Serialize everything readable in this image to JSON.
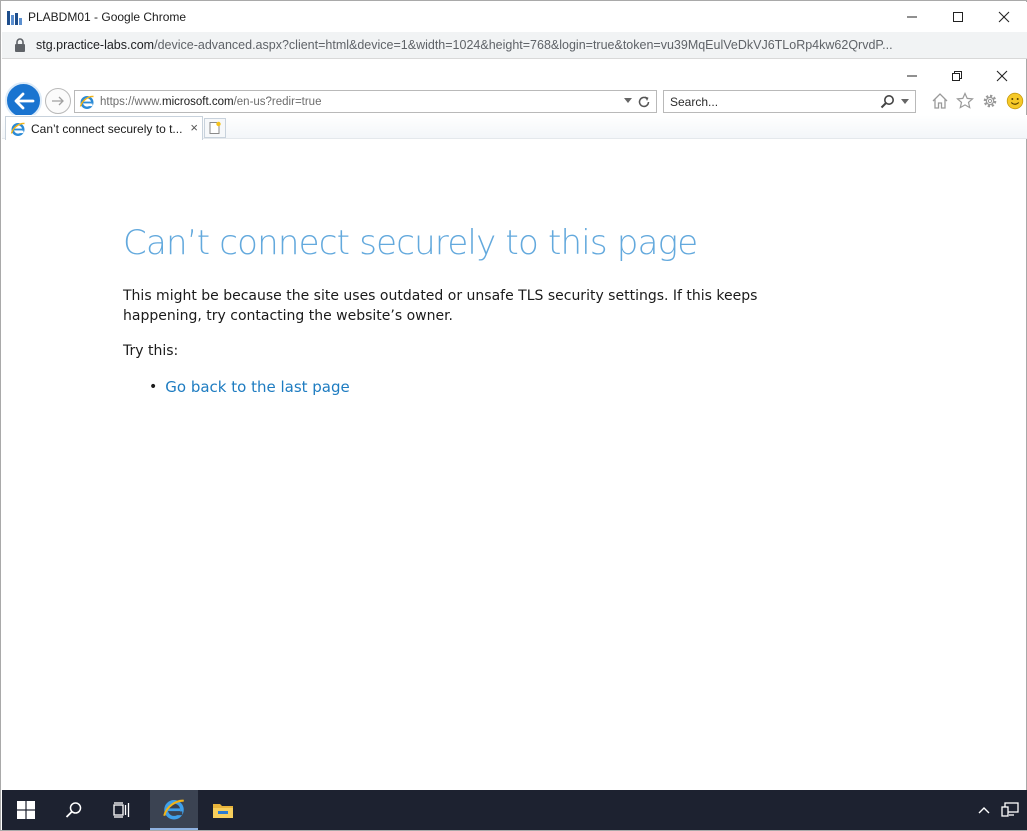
{
  "chrome": {
    "window_title": "PLABDM01 - Google Chrome",
    "url_host": "stg.practice-labs.com",
    "url_path": "/device-advanced.aspx?client=html&device=1&width=1024&height=768&login=true&token=vu39MqEulVeDkVJ6TLoRp4kw62QrvdP..."
  },
  "ie": {
    "address_prefix": "https://www.",
    "address_host": "microsoft.com",
    "address_path": "/en-us?redir=true",
    "search_placeholder": "Search...",
    "tab_title": "Can’t connect securely to t...",
    "tab_close": "×"
  },
  "page": {
    "title": "Can’t connect securely to this page",
    "description": "This might be because the site uses outdated or unsafe TLS security settings. If this keeps happening, try contacting the website’s owner.",
    "try_label": "Try this:",
    "bullet": "•",
    "actions": [
      {
        "label": "Go back to the last page"
      }
    ]
  },
  "colors": {
    "title_blue": "#63a9dd",
    "link_blue": "#1e7cc1",
    "taskbar": "#1d2230",
    "ie_back_blue": "#1a74d0"
  },
  "icons": [
    "chrome-app-icon",
    "lock-icon",
    "minimize-icon",
    "maximize-icon",
    "close-icon",
    "restore-icon",
    "back-arrow-icon",
    "forward-arrow-icon",
    "ie-logo-icon",
    "dropdown-icon",
    "refresh-icon",
    "search-icon",
    "home-icon",
    "favorites-star-icon",
    "gear-icon",
    "smiley-icon",
    "new-tab-icon",
    "windows-start-icon",
    "taskview-icon",
    "file-explorer-icon",
    "chevron-up-icon",
    "network-icon"
  ]
}
